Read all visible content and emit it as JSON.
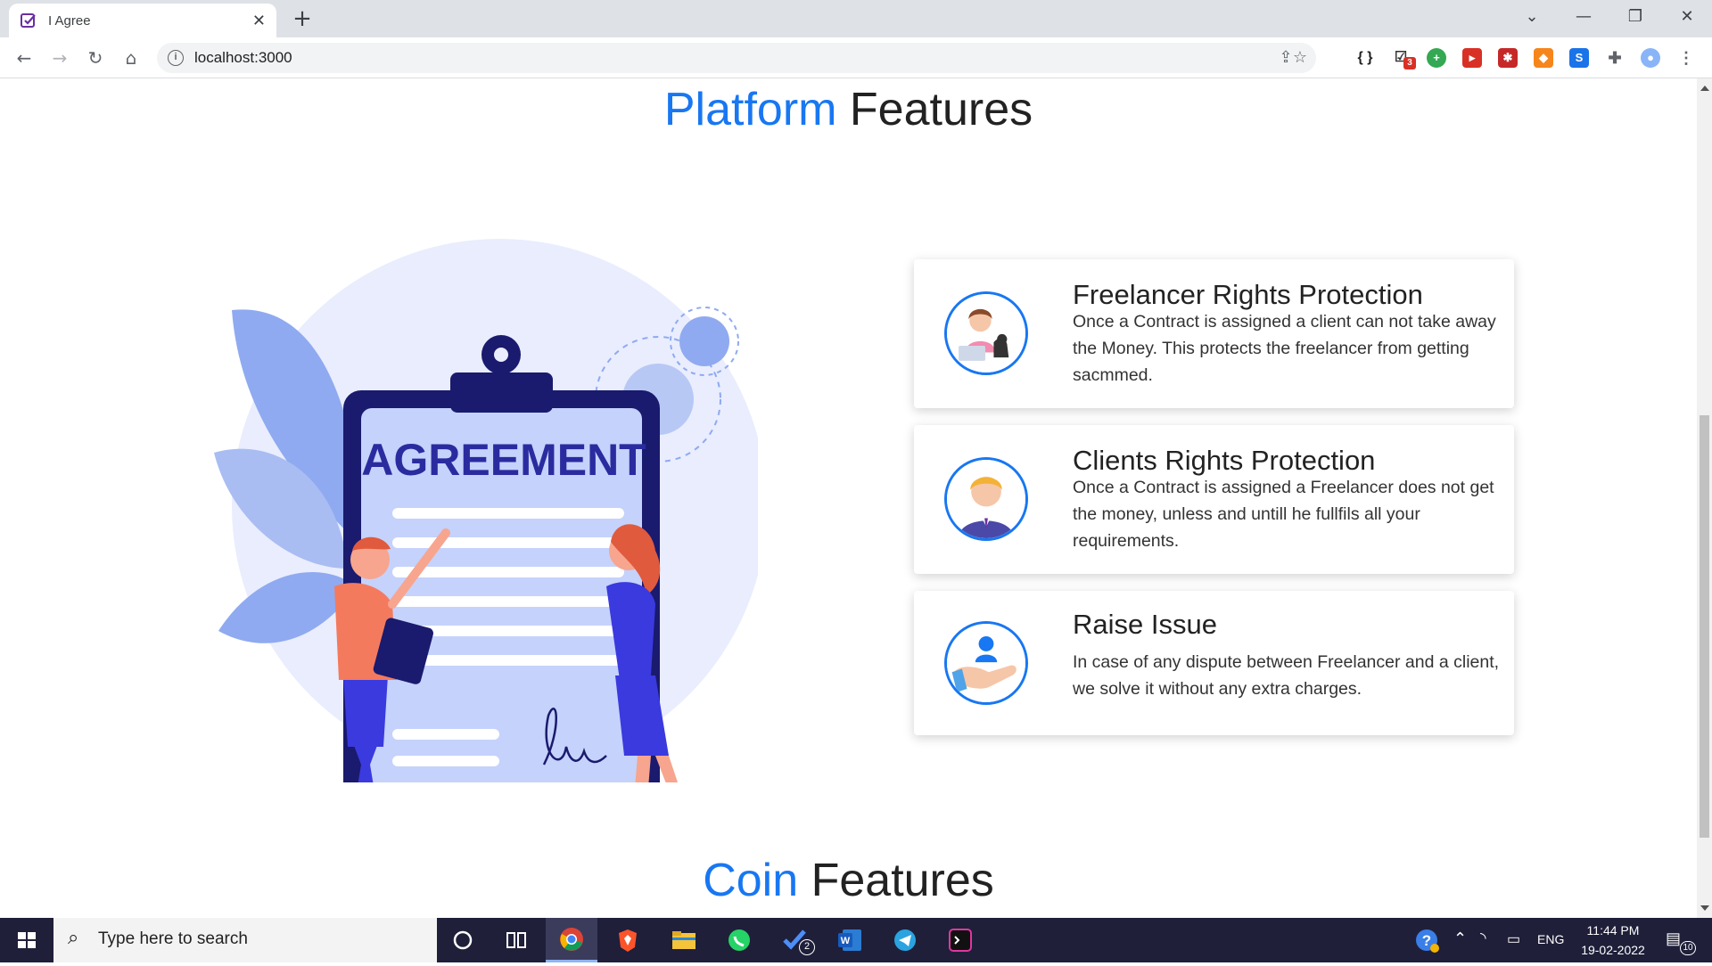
{
  "browser": {
    "tab_title": "I Agree",
    "url": "localhost:3000",
    "extensions_badge": "3"
  },
  "page": {
    "platform_heading": {
      "accent": "Platform",
      "rest": " Features"
    },
    "coin_heading": {
      "accent": "Coin",
      "rest": " Features"
    },
    "illustration_text": "AGREEMENT",
    "features": [
      {
        "title": "Freelancer Rights Protection",
        "description": "Once a Contract is assigned a client can not take away the Money. This protects the freelancer from getting sacmmed.",
        "icon": "freelancer-icon"
      },
      {
        "title": "Clients Rights Protection",
        "description": "Once a Contract is assigned a Freelancer does not get the money, unless and untill he fullfils all your requirements.",
        "icon": "client-icon"
      },
      {
        "title": "Raise Issue",
        "description": "In case of any dispute between Freelancer and a client, we solve it without any extra charges.",
        "icon": "raise-issue-icon"
      }
    ]
  },
  "taskbar": {
    "search_placeholder": "Type here to search",
    "todo_badge": "2",
    "language": "ENG",
    "time": "11:44 PM",
    "date": "19-02-2022",
    "notifications": "10"
  },
  "colors": {
    "accent": "#1877f2",
    "taskbar": "#1f1f3a"
  }
}
